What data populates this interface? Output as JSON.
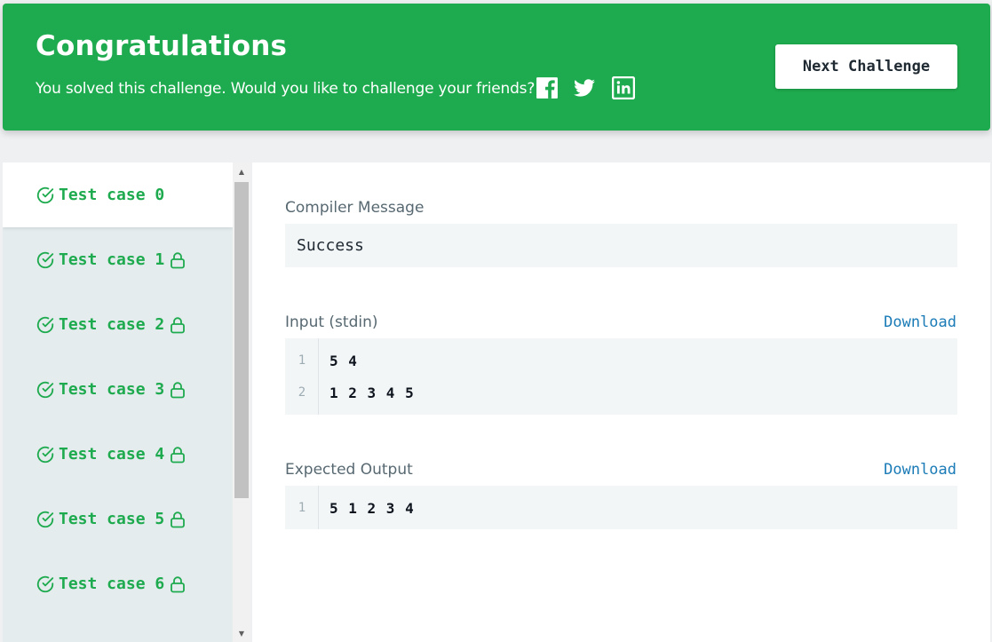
{
  "banner": {
    "title": "Congratulations",
    "subtitle": "You solved this challenge. Would you like to challenge your friends?",
    "share_icons": [
      "facebook-icon",
      "twitter-icon",
      "linkedin-icon"
    ],
    "next_button_label": "Next Challenge"
  },
  "test_cases": [
    {
      "label": "Test case 0",
      "locked": false,
      "active": true
    },
    {
      "label": "Test case 1",
      "locked": true,
      "active": false
    },
    {
      "label": "Test case 2",
      "locked": true,
      "active": false
    },
    {
      "label": "Test case 3",
      "locked": true,
      "active": false
    },
    {
      "label": "Test case 4",
      "locked": true,
      "active": false
    },
    {
      "label": "Test case 5",
      "locked": true,
      "active": false
    },
    {
      "label": "Test case 6",
      "locked": true,
      "active": false
    }
  ],
  "compiler": {
    "label": "Compiler Message",
    "message": "Success"
  },
  "input": {
    "label": "Input (stdin)",
    "download_label": "Download",
    "lines": [
      {
        "num": "1",
        "text": "5 4"
      },
      {
        "num": "2",
        "text": "1 2 3 4 5"
      }
    ]
  },
  "expected": {
    "label": "Expected Output",
    "download_label": "Download",
    "lines": [
      {
        "num": "1",
        "text": "5 1 2 3 4"
      }
    ]
  },
  "colors": {
    "success_green": "#1eaa4e",
    "link_blue": "#1a7bb7"
  }
}
